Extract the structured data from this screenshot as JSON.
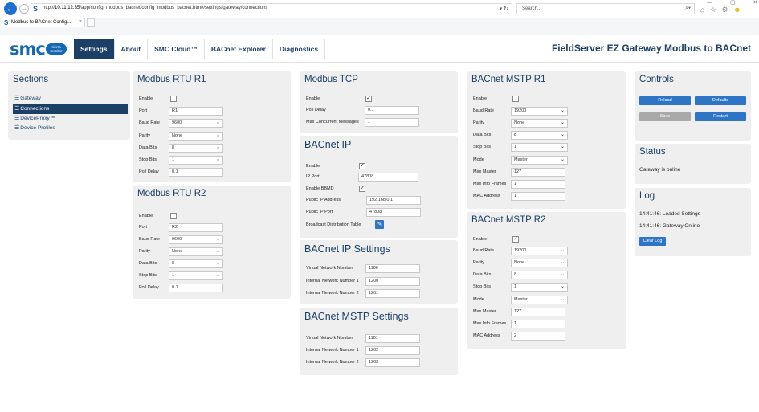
{
  "browser": {
    "url_prefix": "http://",
    "url_host": "10.11.12.35",
    "url_path": "/app/config_modbus_bacnet/config_modbus_bacnet.htm#/settings/gateway/connections",
    "url_controls": "▾ ↻",
    "search_placeholder": "Search...",
    "search_icon": "⌕▾",
    "right_icons": "⌂ ☆ ⚙",
    "smiley": "☻",
    "window_controls": "— ▢ ✕",
    "tab_title": "Modbus to BACnet Config...",
    "tab_close": "×",
    "back_glyph": "←",
    "forward_glyph": "→",
    "site_icon_glyph": "S"
  },
  "header": {
    "logo_text": "smc",
    "logo_sub": "sierra monitor",
    "nav": [
      "Settings",
      "About",
      "SMC Cloud™",
      "BACnet Explorer",
      "Diagnostics"
    ],
    "active_nav": "Settings",
    "app_title": "FieldServer EZ Gateway Modbus to BACnet"
  },
  "sections": {
    "title": "Sections",
    "icon": "☰",
    "items": [
      "Gateway",
      "Connections",
      "DeviceProxy™",
      "Device Profiles"
    ],
    "selected": "Connections"
  },
  "rtu1": {
    "title": "Modbus RTU R1",
    "enable_label": "Enable",
    "enable": "",
    "port_label": "Port",
    "port": "R1",
    "baud_label": "Baud Rate",
    "baud": "9600",
    "parity_label": "Parity",
    "parity": "None",
    "data_bits_label": "Data Bits",
    "data_bits": "8",
    "stop_bits_label": "Stop Bits",
    "stop_bits": "1",
    "poll_delay_label": "Poll Delay",
    "poll_delay": "0.1"
  },
  "rtu2": {
    "title": "Modbus RTU R2",
    "enable_label": "Enable",
    "enable": "",
    "port_label": "Port",
    "port": "R2",
    "baud_label": "Baud Rate",
    "baud": "9600",
    "parity_label": "Parity",
    "parity": "None",
    "data_bits_label": "Data Bits",
    "data_bits": "8",
    "stop_bits_label": "Stop Bits",
    "stop_bits": "1",
    "poll_delay_label": "Poll Delay",
    "poll_delay": "0.1"
  },
  "tcp": {
    "title": "Modbus TCP",
    "enable_label": "Enable",
    "enable": "✓",
    "poll_delay_label": "Poll Delay",
    "poll_delay": "0.1",
    "max_msgs_label": "Max Concurrent Messages",
    "max_msgs": "1"
  },
  "bacnet_ip": {
    "title": "BACnet IP",
    "enable_label": "Enable",
    "enable": "✓",
    "ip_port_label": "IP Port",
    "ip_port": "47808",
    "bbmd_label": "Enable BBMD",
    "bbmd": "✓",
    "public_ip_label": "Public IP Address",
    "public_ip": "192.168.0.1",
    "public_port_label": "Public IP Port",
    "public_port": "47808",
    "bdt_label": "Broadcast Distribution Table",
    "edit_icon": "✎"
  },
  "bacnet_ip_settings": {
    "title": "BACnet IP Settings",
    "vnn_label": "Virtual Network Number",
    "vnn": "1100",
    "inn1_label": "Internal Network Number 1",
    "inn1": "1200",
    "inn2_label": "Internal Network Number 2",
    "inn2": "1201"
  },
  "bacnet_mstp_settings": {
    "title": "BACnet MSTP Settings",
    "vnn_label": "Virtual Network Number",
    "vnn": "1101",
    "inn1_label": "Internal Network Number 1",
    "inn1": "1202",
    "inn2_label": "Internal Network Number 2",
    "inn2": "1203"
  },
  "mstp1": {
    "title": "BACnet MSTP R1",
    "enable_label": "Enable",
    "enable": "",
    "baud_label": "Baud Rate",
    "baud": "19200",
    "parity_label": "Parity",
    "parity": "None",
    "data_bits_label": "Data Bits",
    "data_bits": "8",
    "stop_bits_label": "Stop Bits",
    "stop_bits": "1",
    "mode_label": "Mode",
    "mode": "Master",
    "max_master_label": "Max Master",
    "max_master": "127",
    "max_info_label": "Max Info Frames",
    "max_info": "1",
    "mac_label": "MAC Address",
    "mac": "1"
  },
  "mstp2": {
    "title": "BACnet MSTP R2",
    "enable_label": "Enable",
    "enable": "✓",
    "baud_label": "Baud Rate",
    "baud": "19200",
    "parity_label": "Parity",
    "parity": "None",
    "data_bits_label": "Data Bits",
    "data_bits": "8",
    "stop_bits_label": "Stop Bits",
    "stop_bits": "1",
    "mode_label": "Mode",
    "mode": "Master",
    "max_master_label": "Max Master",
    "max_master": "127",
    "max_info_label": "Max Info Frames",
    "max_info": "1",
    "mac_label": "MAC Address",
    "mac": "2"
  },
  "controls": {
    "title": "Controls",
    "reload": "Reload",
    "defaults": "Defaults",
    "save": "Save",
    "restart": "Restart"
  },
  "status": {
    "title": "Status",
    "text": "Gateway is online"
  },
  "log": {
    "title": "Log",
    "lines": [
      "14:41:46: Loaded Settings",
      "14:41:46: Gateway Online"
    ],
    "clear": "Clear Log"
  },
  "ui_glyphs": {
    "caret": "⌄"
  },
  "colors": {
    "brand": "#1467b3",
    "nav_dark": "#1c3f66",
    "button_blue": "#2e75c6",
    "button_gray": "#a9a9a9",
    "panel_bg": "#efefef"
  }
}
